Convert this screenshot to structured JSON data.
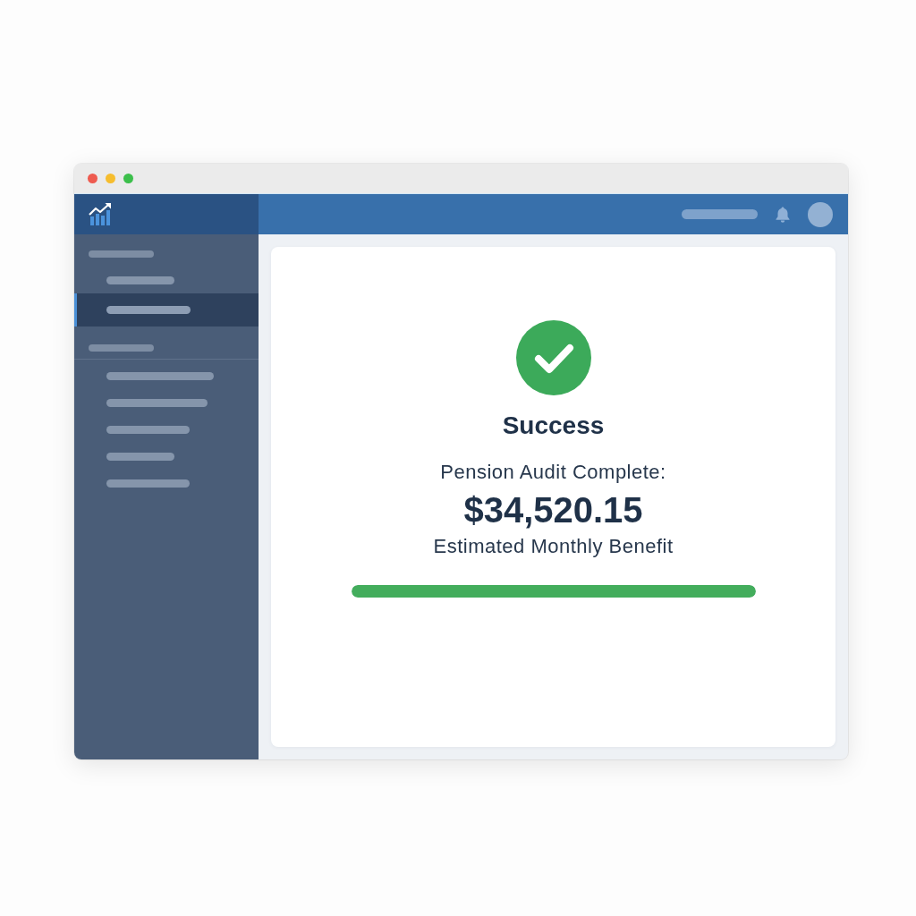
{
  "window": {
    "buttons": [
      {
        "color": "#ee5b50"
      },
      {
        "color": "#f6bd2e"
      },
      {
        "color": "#3cbf4b"
      }
    ]
  },
  "sidebar": {
    "sections": [
      {
        "children": [
          {
            "selected": false
          },
          {
            "selected": true
          }
        ]
      },
      {
        "children": [
          {
            "selected": false
          },
          {
            "selected": false
          },
          {
            "selected": false
          },
          {
            "selected": false
          },
          {
            "selected": false
          }
        ]
      }
    ]
  },
  "status": {
    "title": "Success",
    "message": "Pension Audit Complete:",
    "amount": "$34,520.15",
    "caption": "Estimated Monthly Benefit",
    "progress": {
      "level": 1
    }
  }
}
